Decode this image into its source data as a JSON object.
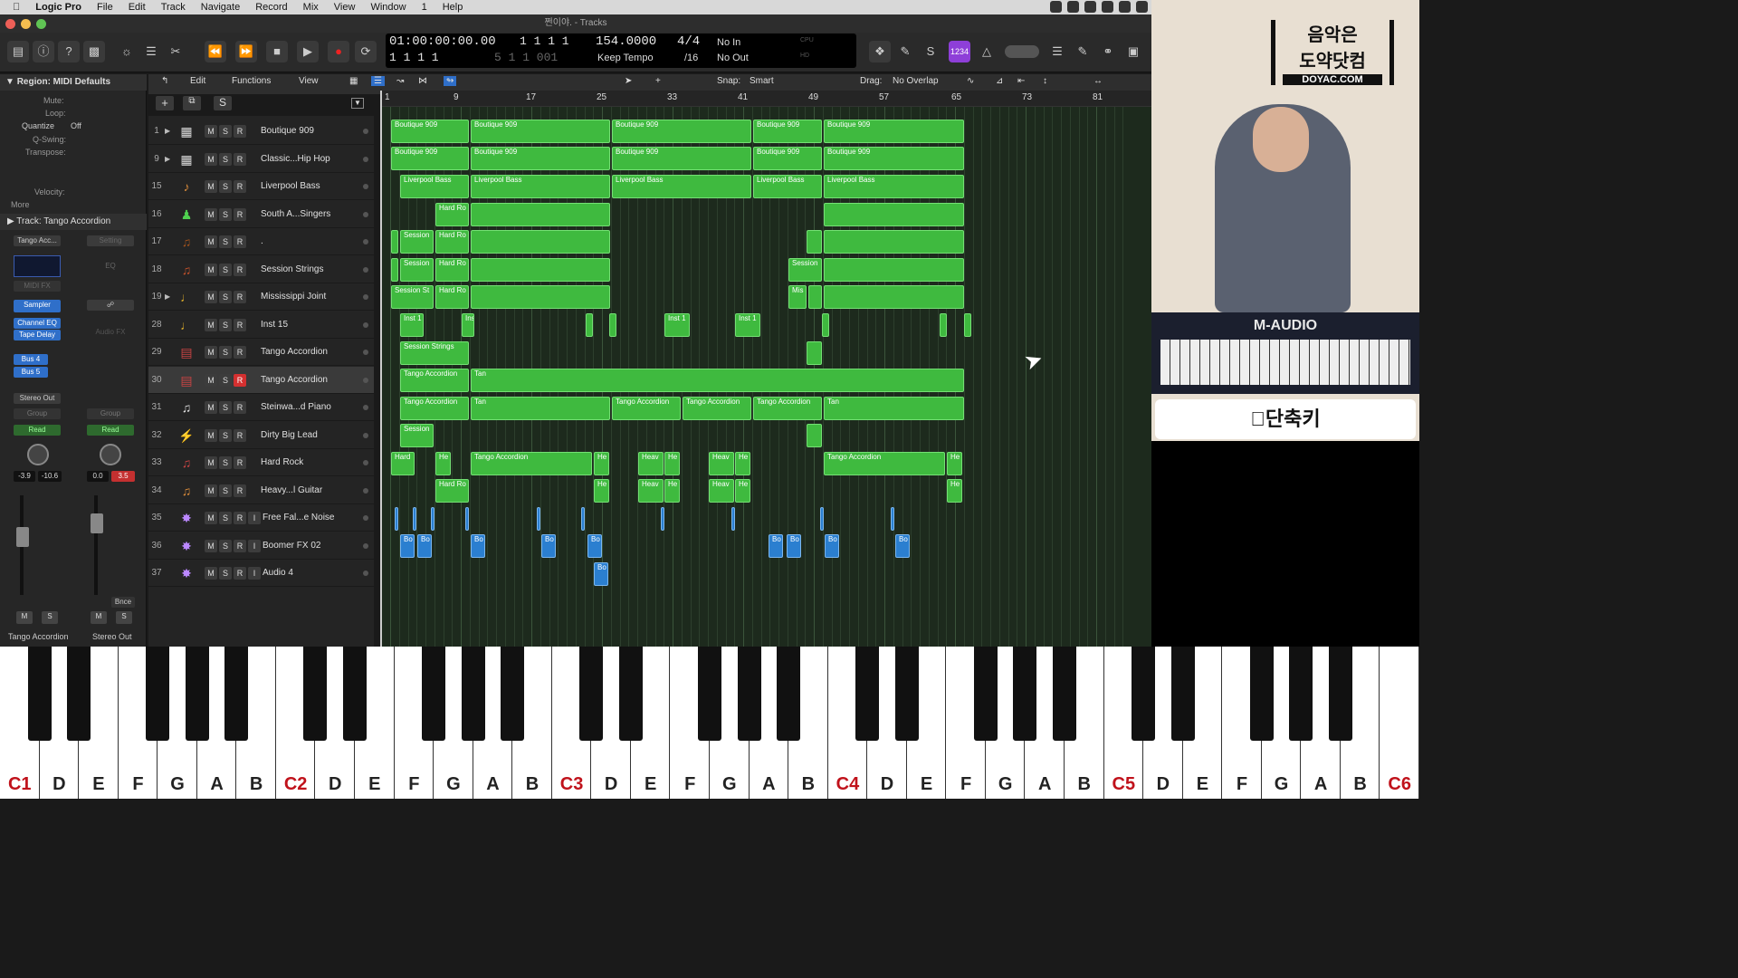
{
  "menubar": {
    "app": "Logic Pro",
    "items": [
      "File",
      "Edit",
      "Track",
      "Navigate",
      "Record",
      "Mix",
      "View",
      "Window",
      "1",
      "Help"
    ]
  },
  "window": {
    "title": "쩐이야. - Tracks"
  },
  "lcd": {
    "time": "01:00:00:00.00",
    "bars_top": "1 1 1 1",
    "bars_dim_top": "001",
    "bars_bottom": "1 1 1 1",
    "bars_dim_bottom": "5 1 1 001",
    "tempo": "154.0000",
    "tempo_mode": "Keep Tempo",
    "signature": "4/4",
    "division": "/16",
    "midi_in": "No In",
    "midi_out": "No Out",
    "cpu": "CPU",
    "hd": "HD"
  },
  "toolbar": {
    "count_in": "1234"
  },
  "inspector": {
    "region_header": "Region: MIDI Defaults",
    "mute": "Mute:",
    "loop": "Loop:",
    "quantize_label": "Quantize",
    "quantize_value": "Off",
    "qswing": "Q-Swing:",
    "transpose": "Transpose:",
    "velocity": "Velocity:",
    "more": "More",
    "track_header": "Track: Tango Accordion",
    "ch1": {
      "name": "Tango Acc...",
      "setting": "Setting",
      "eq": "EQ",
      "midi_fx": "MIDI FX",
      "sampler": "Sampler",
      "channel_eq": "Channel EQ",
      "tape_delay": "Tape Delay",
      "audio_fx": "Audio FX",
      "bus4": "Bus 4",
      "bus5": "Bus 5",
      "output": "Stereo Out",
      "group": "Group",
      "read": "Read",
      "vol": "-3.9",
      "peak": "-10.6",
      "m": "M",
      "s": "S",
      "label": "Tango Accordion"
    },
    "ch2": {
      "group": "Group",
      "read": "Read",
      "vol": "0.0",
      "peak": "3.5",
      "bnce": "Bnce",
      "m": "M",
      "s": "S",
      "label": "Stereo Out"
    }
  },
  "tracks_header": {
    "edit": "Edit",
    "functions": "Functions",
    "view": "View",
    "snap_label": "Snap:",
    "snap_value": "Smart",
    "drag_label": "Drag:",
    "drag_value": "No Overlap"
  },
  "ruler": [
    "1",
    "9",
    "17",
    "25",
    "33",
    "41",
    "49",
    "57",
    "65",
    "73",
    "81"
  ],
  "tracks": [
    {
      "num": "1",
      "name": "Boutique 909",
      "icon": "drum-machine-icon",
      "folder": true
    },
    {
      "num": "9",
      "name": "Classic...Hip Hop",
      "icon": "drum-machine-icon",
      "folder": true
    },
    {
      "num": "15",
      "name": "Liverpool Bass",
      "icon": "bass-icon"
    },
    {
      "num": "16",
      "name": "South A...Singers",
      "icon": "choir-icon"
    },
    {
      "num": "17",
      "name": ".",
      "icon": "violin-icon"
    },
    {
      "num": "18",
      "name": "Session Strings",
      "icon": "strings-icon"
    },
    {
      "num": "19",
      "name": "Mississippi Joint",
      "icon": "horn-icon",
      "folder": true
    },
    {
      "num": "28",
      "name": "Inst 15",
      "icon": "horn-icon"
    },
    {
      "num": "29",
      "name": "Tango Accordion",
      "icon": "accordion-icon"
    },
    {
      "num": "30",
      "name": "Tango Accordion",
      "icon": "accordion-icon",
      "selected": true
    },
    {
      "num": "31",
      "name": "Steinwa...d Piano",
      "icon": "piano-icon"
    },
    {
      "num": "32",
      "name": "Dirty Big Lead",
      "icon": "synth-icon"
    },
    {
      "num": "33",
      "name": "Hard Rock",
      "icon": "guitar-icon"
    },
    {
      "num": "34",
      "name": "Heavy...l Guitar",
      "icon": "guitar-icon"
    },
    {
      "num": "35",
      "name": "Free Fal...e Noise",
      "icon": "fx-icon",
      "input": true
    },
    {
      "num": "36",
      "name": "Boomer FX 02",
      "icon": "fx-icon",
      "input": true
    },
    {
      "num": "37",
      "name": "Audio 4",
      "icon": "fx-icon",
      "input": true
    }
  ],
  "regions_labels": [
    "Boutique 909",
    "Liverpool Bass",
    "Hard Ro",
    "Session",
    "Session St",
    "Mis",
    "Inst 1",
    "Ins",
    "Session Strings",
    "Tango Accordion",
    "Tan",
    "Hard",
    "He",
    "Heav",
    "Bo"
  ],
  "video": {
    "logo_line1": "음악은",
    "logo_line2": "도약닷컴",
    "logo_url": "DOYAC.COM",
    "keyboard_brand": "M-AUDIO",
    "shortcut_label": "단축키"
  },
  "piano_labels": [
    "C1",
    "D",
    "E",
    "F",
    "G",
    "A",
    "B",
    "C2",
    "D",
    "E",
    "F",
    "G",
    "A",
    "B",
    "C3",
    "D",
    "E",
    "F",
    "G",
    "A",
    "B",
    "C4",
    "D",
    "E",
    "F",
    "G",
    "A",
    "B",
    "C5",
    "D",
    "E",
    "F",
    "G",
    "A",
    "B",
    "C6"
  ]
}
